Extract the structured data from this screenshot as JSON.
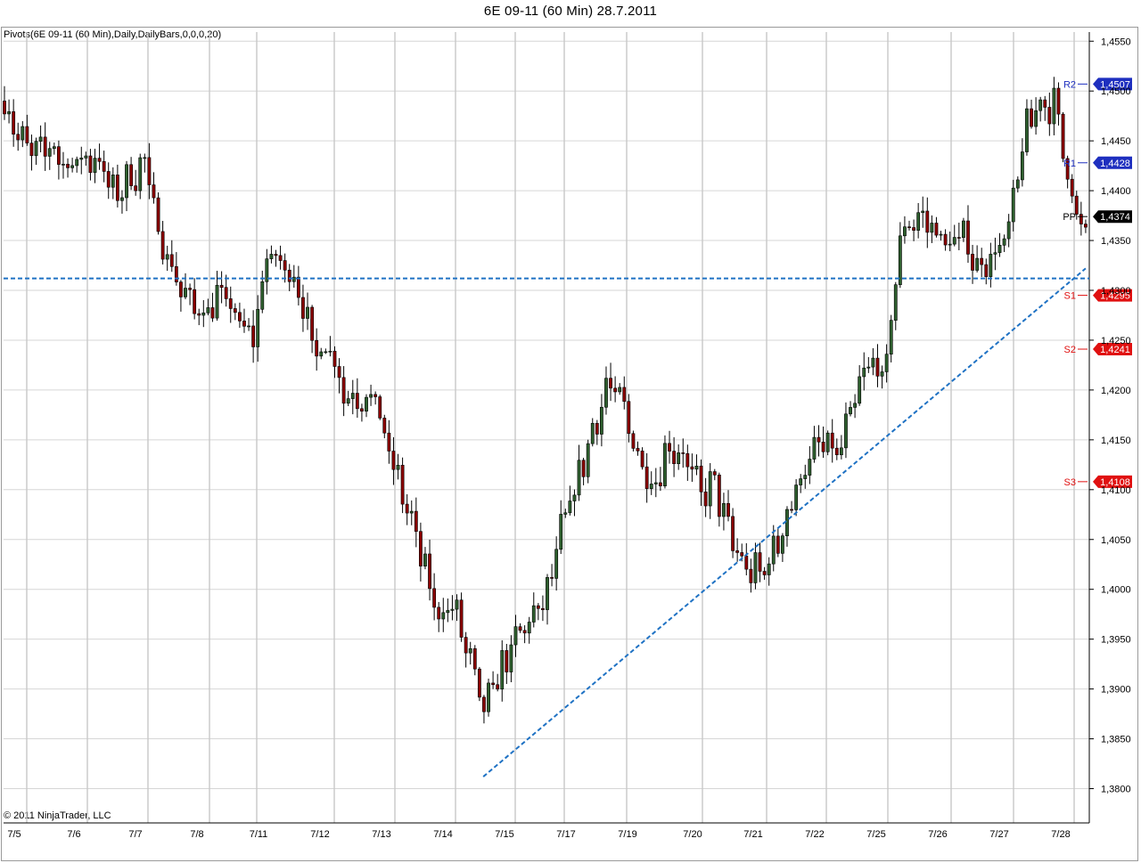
{
  "window": {
    "title": "6E 09-11 (60 Min)  28.7.2011"
  },
  "indicator": {
    "label": "Pivots(6E 09-11 (60 Min),Daily,DailyBars,0,0,0,20)"
  },
  "footer": {
    "copyright": "© 2011 NinjaTrader, LLC"
  },
  "colors": {
    "up_candle": "#2e5f2e",
    "down_candle": "#8b0000",
    "candle_outline": "#000000",
    "resistance": "#1e2fbf",
    "support": "#e01010",
    "pivot": "#000000",
    "drawing": "#1f72c4",
    "grid": "#d6d6d6"
  },
  "chart_data": {
    "type": "candlestick",
    "title": "6E 09-11 (60 Min)  28.7.2011",
    "xlabel": "",
    "ylabel": "",
    "ylim": [
      1.378,
      1.458
    ],
    "y_ticks": [
      "1,4550",
      "1,4500",
      "1,4450",
      "1,4400",
      "1,4350",
      "1,4300",
      "1,4250",
      "1,4200",
      "1,4150",
      "1,4100",
      "1,4050",
      "1,4000",
      "1,3950",
      "1,3900",
      "1,3850",
      "1,3800"
    ],
    "y_tick_values": [
      1.455,
      1.45,
      1.445,
      1.44,
      1.435,
      1.43,
      1.425,
      1.42,
      1.415,
      1.41,
      1.405,
      1.4,
      1.395,
      1.39,
      1.385,
      1.38
    ],
    "x_ticks": [
      "7/5",
      "7/6",
      "7/7",
      "7/8",
      "7/11",
      "7/12",
      "7/13",
      "7/14",
      "7/15",
      "7/17",
      "7/19",
      "7/20",
      "7/21",
      "7/22",
      "7/25",
      "7/26",
      "7/27",
      "7/28"
    ],
    "grid": true,
    "price_series": {
      "name": "6E 09-11",
      "x": [
        0,
        1,
        2,
        3,
        4,
        5,
        6,
        7,
        8,
        9,
        10,
        11,
        12,
        13,
        14,
        15,
        16,
        17,
        18,
        19,
        20,
        21,
        22,
        23,
        24,
        25,
        26,
        27,
        28,
        29,
        30,
        31,
        32,
        33,
        34,
        35,
        36,
        37,
        38,
        39,
        40,
        41,
        42,
        43,
        44,
        45,
        46,
        47,
        48,
        49,
        50,
        51,
        52,
        53,
        54,
        55,
        56,
        57,
        58,
        59,
        60,
        61,
        62,
        63,
        64,
        65,
        66,
        67,
        68,
        69,
        70
      ],
      "close": [
        1.449,
        1.445,
        1.4435,
        1.4445,
        1.4425,
        1.443,
        1.4435,
        1.4395,
        1.441,
        1.443,
        1.436,
        1.4315,
        1.4285,
        1.428,
        1.4295,
        1.4275,
        1.4245,
        1.4335,
        1.4325,
        1.431,
        1.4235,
        1.425,
        1.4195,
        1.4195,
        1.419,
        1.413,
        1.4085,
        1.403,
        1.3975,
        1.3985,
        1.3935,
        1.3875,
        1.3915,
        1.3945,
        1.397,
        1.3985,
        1.4055,
        1.4105,
        1.4155,
        1.4205,
        1.4185,
        1.4135,
        1.4105,
        1.4145,
        1.4135,
        1.4095,
        1.4105,
        1.405,
        1.402,
        1.4015,
        1.4045,
        1.409,
        1.413,
        1.4145,
        1.4135,
        1.4185,
        1.423,
        1.421,
        1.4355,
        1.4375,
        1.4365,
        1.4345,
        1.4355,
        1.4325,
        1.4335,
        1.4355,
        1.4455,
        1.449,
        1.4485,
        1.4405,
        1.4345
      ]
    },
    "pivot_levels": [
      {
        "label": "R2",
        "value": 1.4507,
        "badge": "1,4507",
        "color": "#1e2fbf"
      },
      {
        "label": "R1",
        "value": 1.4428,
        "badge": "1,4428",
        "color": "#1e2fbf"
      },
      {
        "label": "PP",
        "value": 1.4374,
        "badge": "1,4374",
        "color": "#000000"
      },
      {
        "label": "S1",
        "value": 1.4295,
        "badge": "1,4295",
        "color": "#e01010"
      },
      {
        "label": "S2",
        "value": 1.4241,
        "badge": "1,4241",
        "color": "#e01010"
      },
      {
        "label": "S3",
        "value": 1.4108,
        "badge": "1,4108",
        "color": "#e01010"
      }
    ],
    "drawings": [
      {
        "type": "horizontal-line",
        "style": "dashed",
        "value": 1.4312
      },
      {
        "type": "trend-line",
        "style": "dashed",
        "from": {
          "x": 31,
          "y": 1.3812
        },
        "to": {
          "x": 70,
          "y": 1.4322
        }
      }
    ]
  }
}
